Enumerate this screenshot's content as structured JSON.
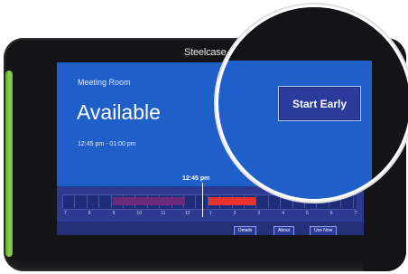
{
  "device": {
    "brand": "Steelcase"
  },
  "screen": {
    "room_name": "Meeting Room",
    "status": "Available",
    "time_range": "12:45 pm - 01:00 pm",
    "now_label": "12:45 pm",
    "hours": [
      "7",
      "8",
      "9",
      "10",
      "11",
      "12",
      "1",
      "2",
      "3",
      "4",
      "5",
      "6",
      "7"
    ],
    "buttons": {
      "details": "Details",
      "about": "About",
      "use_now": "Use Now"
    },
    "colors": {
      "screen_bg": "#1f5fc9",
      "busy_block": "#6b2b7a",
      "booked_block": "#e8342d",
      "led_bar": "#8fd24a"
    }
  },
  "zoom": {
    "start_early_label": "Start Early"
  }
}
